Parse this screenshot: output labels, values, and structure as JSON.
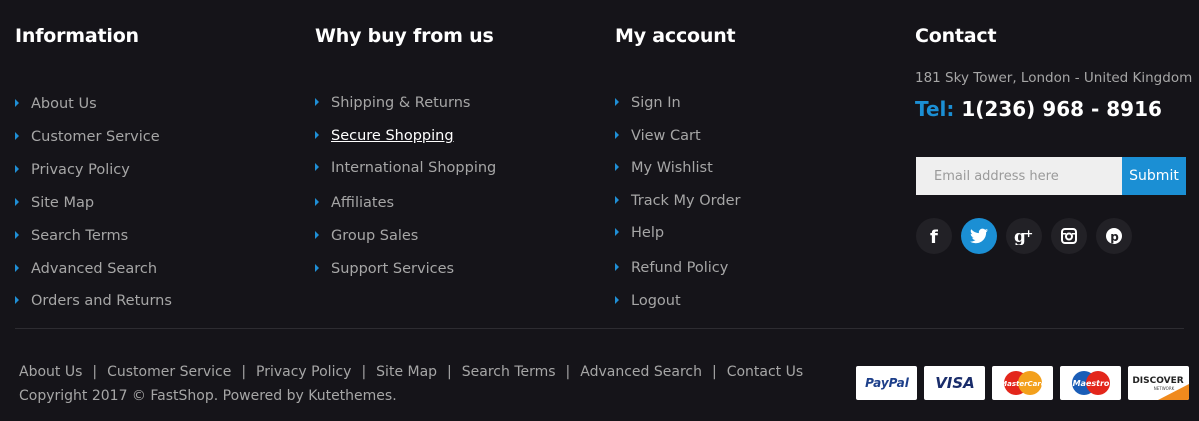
{
  "columns": [
    {
      "title": "Information",
      "items": [
        "About Us",
        "Customer Service",
        "Privacy Policy",
        "Site Map",
        "Search Terms",
        "Advanced Search",
        "Orders and Returns"
      ]
    },
    {
      "title": "Why buy from us",
      "items": [
        "Shipping & Returns",
        "Secure Shopping",
        "International Shopping",
        "Affiliates",
        "Group Sales",
        "Support Services"
      ]
    },
    {
      "title": "My account",
      "items": [
        "Sign In",
        "View Cart",
        "My Wishlist",
        "Track My Order",
        "Help",
        "Refund Policy",
        "Logout"
      ]
    }
  ],
  "contact": {
    "title": "Contact",
    "address": "181 Sky Tower, London - United Kingdom",
    "tel_label": "Tel:",
    "tel_number": "1(236) 968 - 8916"
  },
  "newsletter": {
    "placeholder": "Email address here",
    "submit_label": "Submit"
  },
  "social": [
    "facebook-icon",
    "twitter-icon",
    "google-plus-icon",
    "instagram-icon",
    "pinterest-icon"
  ],
  "bottom_links": [
    "About Us",
    "Customer Service",
    "Privacy Policy",
    "Site Map",
    "Search Terms",
    "Advanced Search",
    "Contact Us"
  ],
  "copyright": "Copyright 2017 © FastShop. Powered by Kutethemes.",
  "payments": {
    "paypal": "PayPal",
    "visa": "VISA",
    "mastercard": "MasterCard",
    "maestro": "Maestro",
    "discover": "DISCOVER",
    "discover_sub": "NETWORK"
  },
  "colors": {
    "background": "#151419",
    "accent": "#1b8fd4",
    "text": "#a6a6a6"
  }
}
